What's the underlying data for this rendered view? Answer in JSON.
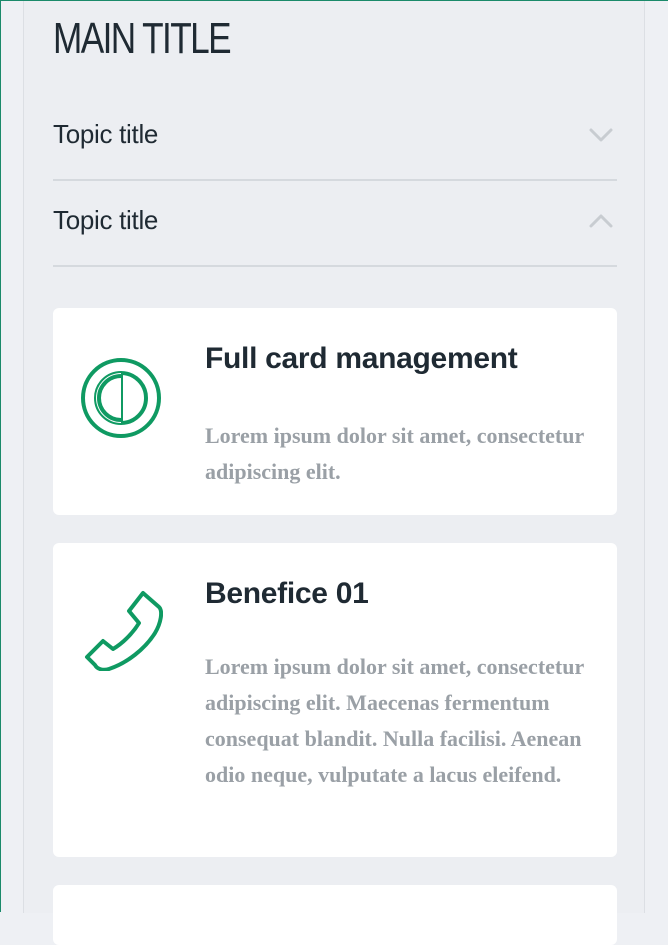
{
  "main_title": "MAIN TITLE",
  "topics": [
    {
      "label": "Topic title",
      "state": "collapsed",
      "icon": "chevron-down-icon"
    },
    {
      "label": "Topic title",
      "state": "expanded",
      "icon": "chevron-up-icon"
    }
  ],
  "cards": [
    {
      "icon": "half-circle-icon",
      "title": "Full card management",
      "text": "Lorem ipsum dolor sit amet, consectetur adipiscing elit."
    },
    {
      "icon": "phone-icon",
      "title": "Benefice 01",
      "text": "Lorem ipsum dolor sit amet, consectetur adipiscing elit. Maecenas fermentum consequat blandit. Nulla facilisi. Aenean odio neque, vulputate a lacus eleifend."
    }
  ],
  "colors": {
    "accent": "#0f9a62",
    "title": "#1f2a33",
    "muted_text": "#9aa0a6",
    "divider": "#d5d9de",
    "chevron": "#c8ccd1"
  }
}
